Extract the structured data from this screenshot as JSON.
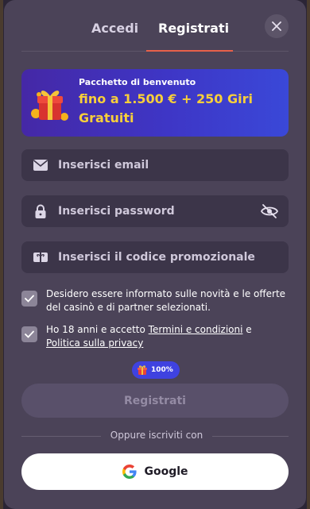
{
  "tabs": {
    "login": "Accedi",
    "register": "Registrati"
  },
  "banner": {
    "subtitle": "Pacchetto di benvenuto",
    "offer": "fino a 1.500 € + 250 Giri Gratuiti"
  },
  "fields": {
    "email_placeholder": "Inserisci email",
    "password_placeholder": "Inserisci password",
    "promo_placeholder": "Inserisci il codice promozionale"
  },
  "consent": {
    "marketing": "Desidero essere informato sulle novità e le offerte del casinò e di partner selezionati.",
    "age_prefix": "Ho 18 anni e accetto ",
    "terms_link": "Termini e condizioni",
    "age_middle": " e ",
    "privacy_link": "Politica sulla privacy"
  },
  "progress": {
    "label": "100%",
    "value": 1.0
  },
  "submit_label": "Registrati",
  "social": {
    "or_text": "Oppure iscriviti con",
    "google_label": "Google"
  },
  "colors": {
    "accent": "#e8614a",
    "banner_text": "#f8cf3a",
    "badge": "#3f42e0"
  }
}
